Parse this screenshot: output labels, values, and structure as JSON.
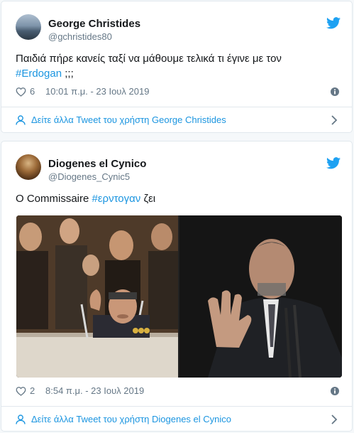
{
  "colors": {
    "link": "#1b95e0",
    "muted": "#657786",
    "text": "#14171a",
    "border": "#e1e8ed"
  },
  "tweets": [
    {
      "name": "George Christides",
      "handle": "@gchristides80",
      "text_before": "Παιδιά πήρε κανείς ταξί να μάθουμε τελικά τι έγινε με τον",
      "hashtag": "#Erdogan",
      "text_after": " ;;;",
      "likes": "6",
      "timestamp": "10:01 π.μ. - 23 Ιουλ 2019",
      "more_tweets": "Δείτε άλλα Tweet του χρήστη George Christides"
    },
    {
      "name": "Diogenes el Cynico",
      "handle": "@Diogenes_Cynic5",
      "text_before": "Ο Commissaire ",
      "hashtag": "#ερντογαν",
      "text_after": " ζει",
      "likes": "2",
      "timestamp": "8:54 π.μ. - 23 Ιουλ 2019",
      "more_tweets": "Δείτε άλλα Tweet του χρήστη Diogenes el Cynico"
    }
  ],
  "icons": {
    "brand": "twitter-bird-icon",
    "like": "heart-icon",
    "info": "info-icon",
    "user": "user-icon",
    "more": "chevron-right-icon"
  }
}
